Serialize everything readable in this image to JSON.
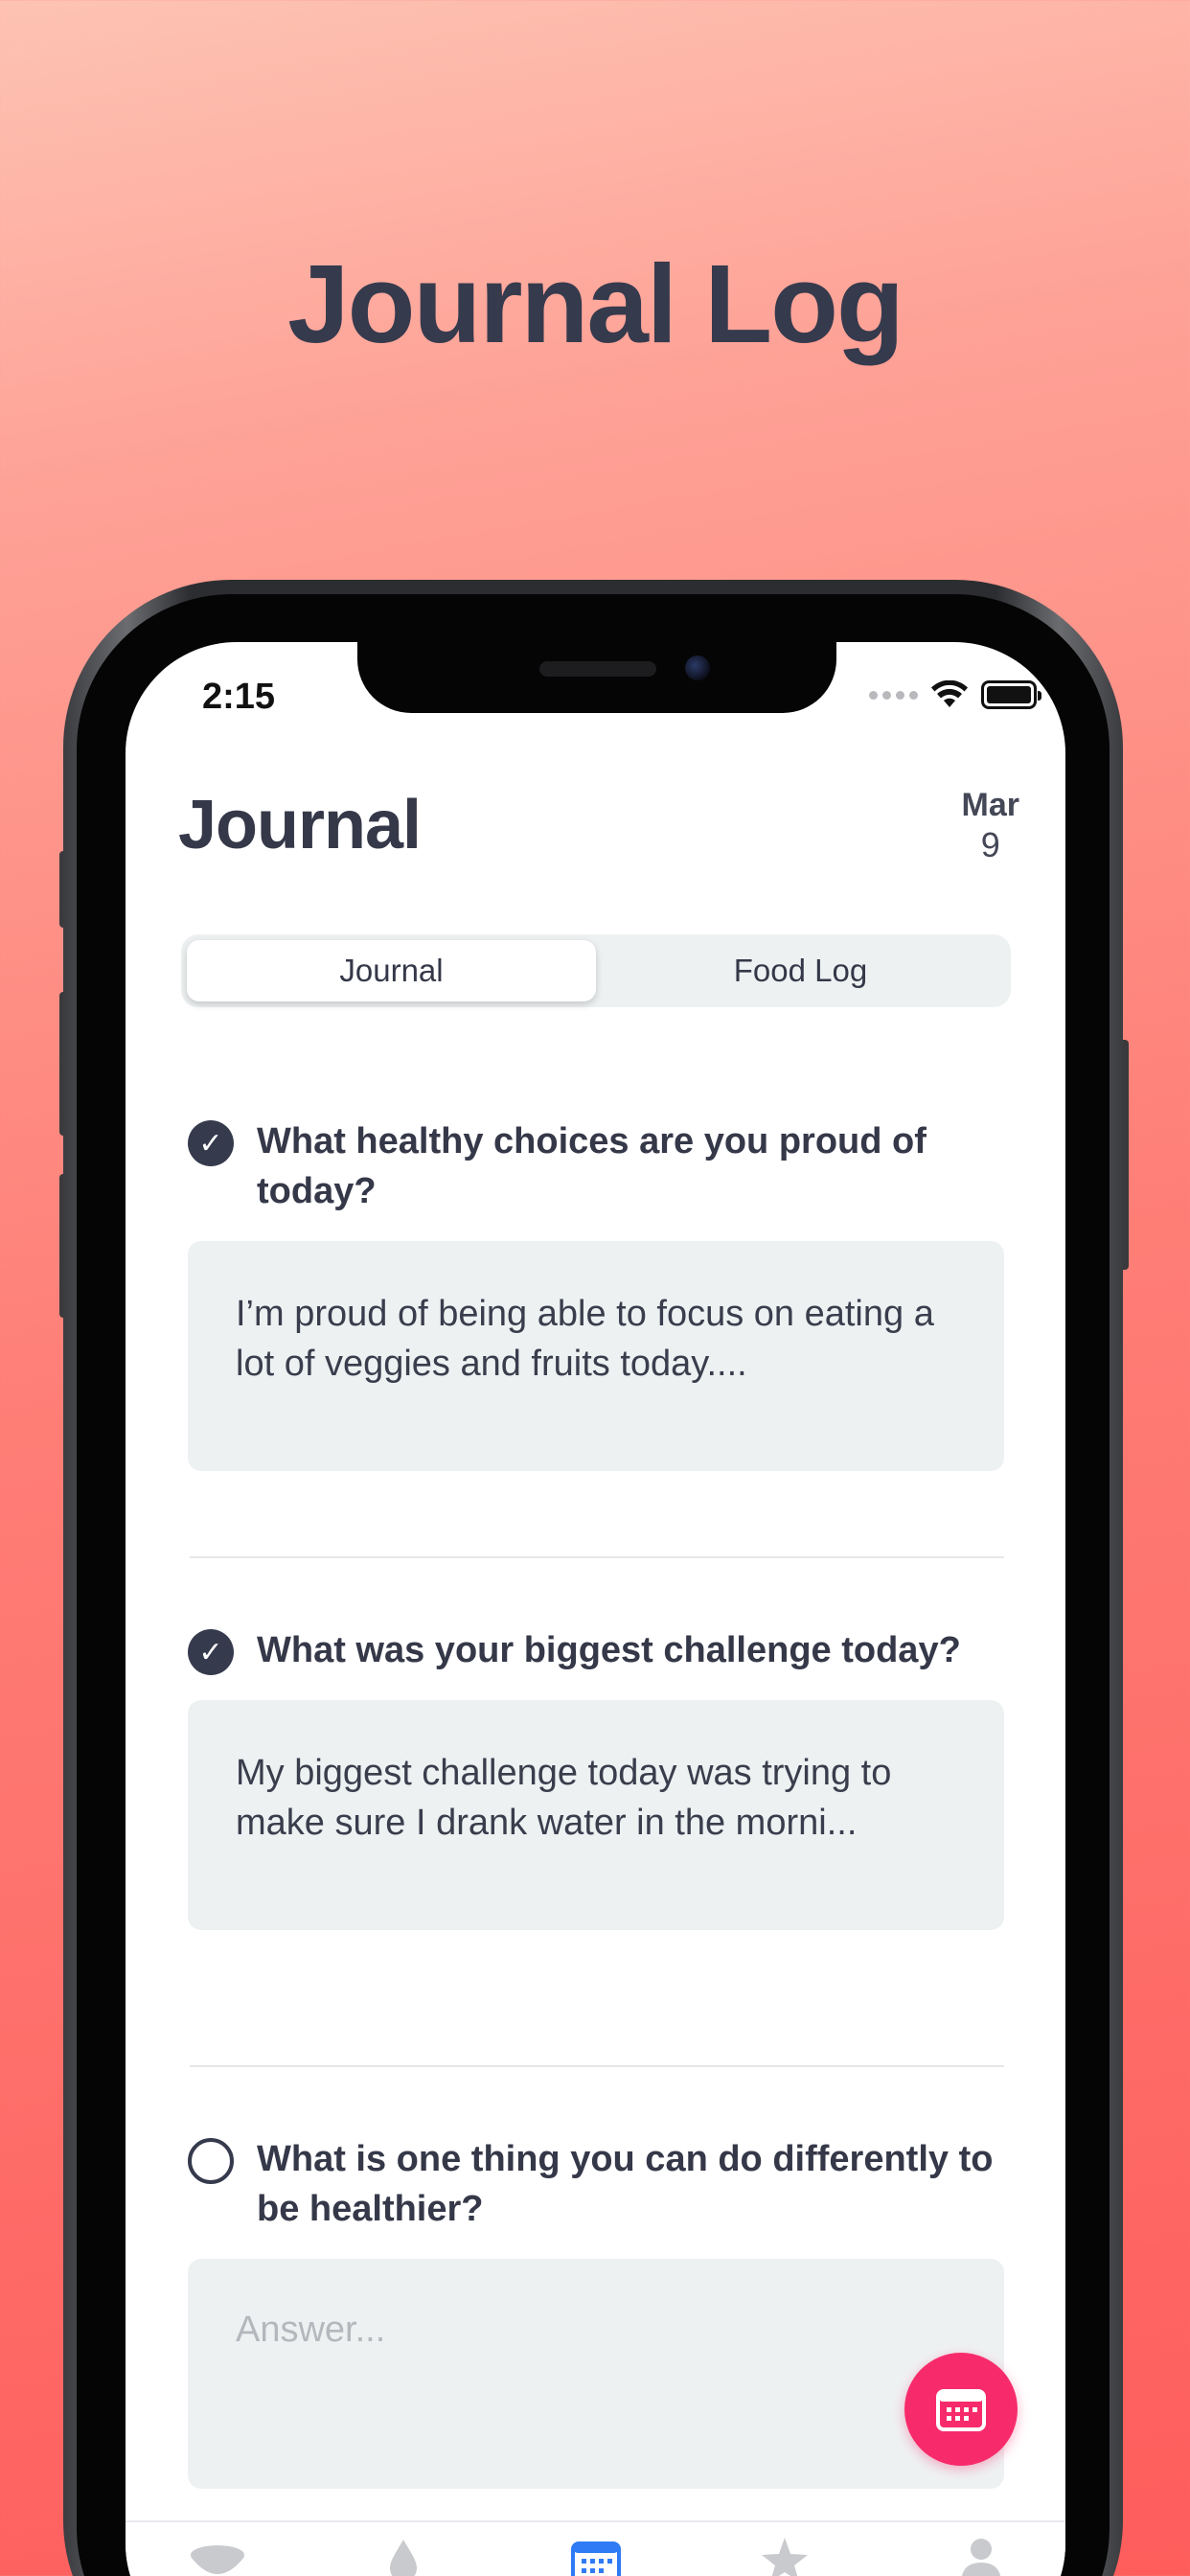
{
  "headline": "Journal Log",
  "status": {
    "time": "2:15"
  },
  "header": {
    "title": "Journal",
    "date_month": "Mar",
    "date_day": "9"
  },
  "segments": [
    {
      "label": "Journal",
      "active": true
    },
    {
      "label": "Food Log",
      "active": false
    }
  ],
  "questions": [
    {
      "question": "What healthy choices are you proud of today?",
      "answer": "I’m proud of being able to focus on eating a lot of veggies and fruits today....",
      "completed": true
    },
    {
      "question": "What was your biggest challenge today?",
      "answer": "My biggest challenge today was trying to make sure I drank water in the morni...",
      "completed": true
    },
    {
      "question": "What is one thing you can do differently to be healthier?",
      "answer": "",
      "placeholder": "Answer...",
      "completed": false
    }
  ],
  "tabbar": {
    "items": [
      {
        "icon": "bowl-icon",
        "active": false
      },
      {
        "icon": "water-drop-icon",
        "active": false
      },
      {
        "icon": "calendar-icon",
        "active": true
      },
      {
        "icon": "star-icon",
        "active": false
      },
      {
        "icon": "person-icon",
        "active": false
      }
    ]
  },
  "colors": {
    "accent": "#f72b6b",
    "tab_active": "#2f7bf5",
    "text": "#353848",
    "field_bg": "#eef1f2"
  }
}
